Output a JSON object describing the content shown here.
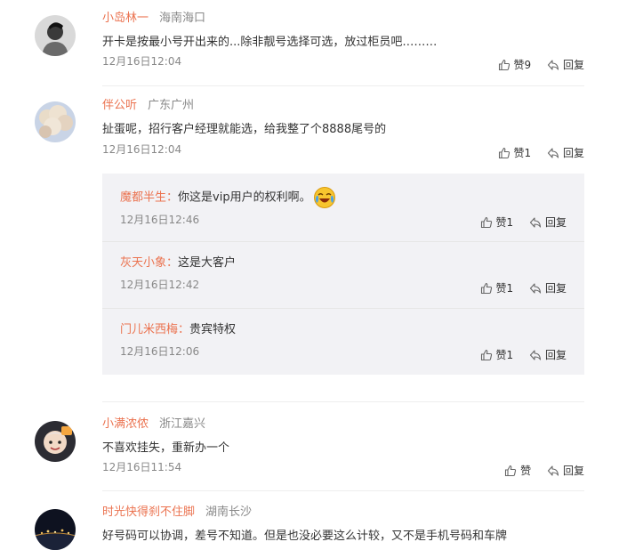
{
  "comments": [
    {
      "user": "小岛林一",
      "location": "海南海口",
      "text": "开卡是按最小号开出来的...除非靓号选择可选，放过柜员吧………",
      "time": "12月16日12:04",
      "like_label": "赞9",
      "reply_label": "回复"
    },
    {
      "user": "伴公听",
      "location": "广东广州",
      "text": "扯蛋呢，招行客户经理就能选，给我整了个8888尾号的",
      "time": "12月16日12:04",
      "like_label": "赞1",
      "reply_label": "回复"
    },
    {
      "user": "小满浓侬",
      "location": "浙江嘉兴",
      "text": "不喜欢挂失，重新办一个",
      "time": "12月16日11:54",
      "like_label": "赞",
      "reply_label": "回复"
    },
    {
      "user": "时光快得刹不住脚",
      "location": "湖南长沙",
      "text": "好号码可以协调，差号不知道。但是也没必要这么计较，又不是手机号码和车牌"
    }
  ],
  "replies": [
    {
      "user": "魔都半生",
      "text": "你这是vip用户的权利啊。",
      "emoji": "laugh-cry-emoji",
      "time": "12月16日12:46",
      "like_label": "赞1",
      "reply_label": "回复"
    },
    {
      "user": "灰天小象",
      "text": "这是大客户",
      "time": "12月16日12:42",
      "like_label": "赞1",
      "reply_label": "回复"
    },
    {
      "user": "门儿米西梅",
      "text": "贵宾特权",
      "time": "12月16日12:06",
      "like_label": "赞1",
      "reply_label": "回复"
    }
  ],
  "colors": {
    "username": "#eb7350",
    "muted": "#888888",
    "reply_bg": "#f2f2f5",
    "text": "#333333"
  }
}
